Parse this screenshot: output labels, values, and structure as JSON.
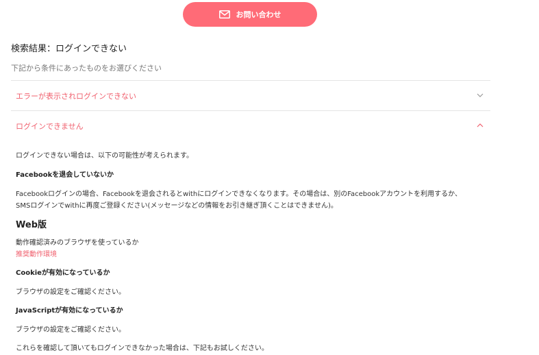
{
  "contact_button": {
    "label": "お問い合わせ",
    "icon": "mail-icon"
  },
  "search": {
    "title": "検索結果：ログインできない",
    "subtitle": "下記から条件にあったものをお選びください"
  },
  "faq": [
    {
      "question": "エラーが表示されログインできない",
      "expanded": false,
      "icon": "chevron-down-icon"
    },
    {
      "question": "ログインできません",
      "expanded": true,
      "icon": "chevron-up-icon"
    }
  ],
  "answer": {
    "intro": "ログインできない場合は、以下の可能性が考えられます。",
    "facebook_heading": "Facebookを退会していないか",
    "facebook_text_1": "Facebookログインの場合、Facebookを退会されるとwithにログインできなくなります。その場合は、別のFacebookアカウントを利用するか、",
    "facebook_text_2": "SMSログインでwithに再度ご登録ください(メッセージなどの情報をお引き継ぎ頂くことはできません)。",
    "web_heading": "Web版",
    "browser_text": "動作確認済みのブラウザを使っているか",
    "browser_link": "推奨動作環境",
    "cookie_heading": "Cookieが有効になっているか",
    "cookie_text": "ブラウザの設定をご確認ください。",
    "js_heading": "JavaScriptが有効になっているか",
    "js_text": "ブラウザの設定をご確認ください。",
    "closing": "これらを確認して頂いてもログインできなかった場合は、下記もお試しください。"
  },
  "colors": {
    "accent": "#ff6b77",
    "link": "#f0606e",
    "divider": "#e4e4e4"
  }
}
